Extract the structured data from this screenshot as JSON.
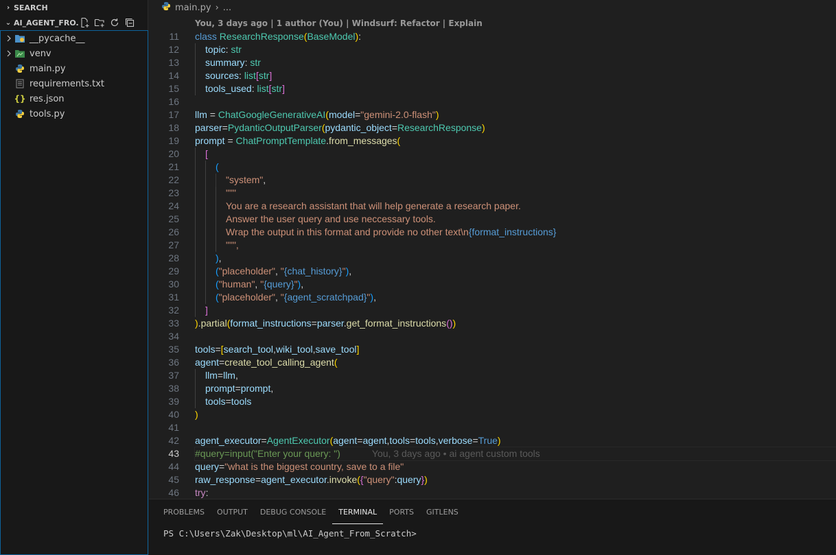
{
  "sidebar": {
    "search_label": "SEARCH",
    "folder_title": "AI_AGENT_FRO...",
    "items": [
      {
        "label": "__pycache__",
        "type": "folder",
        "icon": "folder-icon"
      },
      {
        "label": "venv",
        "type": "folder",
        "icon": "folder-icon"
      },
      {
        "label": "main.py",
        "type": "file",
        "icon": "python-icon"
      },
      {
        "label": "requirements.txt",
        "type": "file",
        "icon": "text-file-icon"
      },
      {
        "label": "res.json",
        "type": "file",
        "icon": "json-icon"
      },
      {
        "label": "tools.py",
        "type": "file",
        "icon": "python-icon"
      }
    ]
  },
  "editor": {
    "breadcrumb_file": "main.py",
    "breadcrumb_more": "...",
    "codelens": "You, 3 days ago | 1 author (You) | Windsurf: Refactor | Explain",
    "blame": "You, 3 days ago • ai agent custom tools",
    "line_numbers": [
      "11",
      "12",
      "13",
      "14",
      "15",
      "16",
      "17",
      "18",
      "19",
      "20",
      "21",
      "22",
      "23",
      "24",
      "25",
      "26",
      "27",
      "28",
      "29",
      "30",
      "31",
      "32",
      "33",
      "34",
      "35",
      "36",
      "37",
      "38",
      "39",
      "40",
      "41",
      "42",
      "43",
      "44",
      "45",
      "46"
    ],
    "current_line": "43"
  },
  "panel": {
    "tabs": [
      "PROBLEMS",
      "OUTPUT",
      "DEBUG CONSOLE",
      "TERMINAL",
      "PORTS",
      "GITLENS"
    ],
    "active_tab": "TERMINAL",
    "terminal_prompt": "PS C:\\Users\\Zak\\Desktop\\ml\\AI_Agent_From_Scratch>"
  },
  "colors": {
    "accent": "#0e639c",
    "background": "#1f1f1f",
    "sidebar": "#181818"
  }
}
